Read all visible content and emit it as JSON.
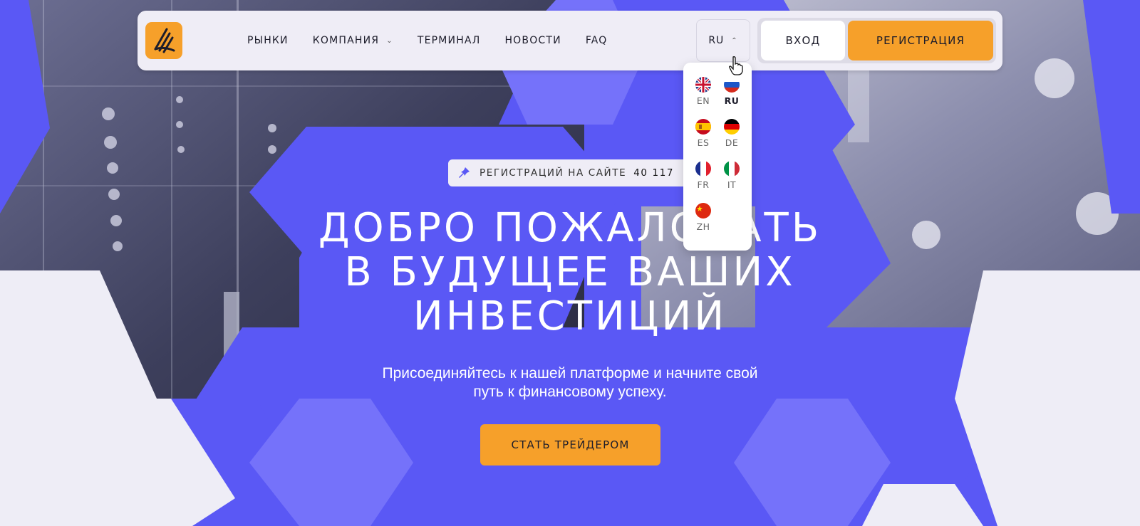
{
  "colors": {
    "accent": "#5a58f5",
    "brand_orange": "#f6a02a",
    "light": "#efedf6"
  },
  "header": {
    "logo_icon": "brand-logo-icon",
    "nav": [
      {
        "label": "РЫНКИ",
        "has_dropdown": false
      },
      {
        "label": "КОМПАНИЯ",
        "has_dropdown": true
      },
      {
        "label": "ТЕРМИНАЛ",
        "has_dropdown": false
      },
      {
        "label": "НОВОСТИ",
        "has_dropdown": false
      },
      {
        "label": "FAQ",
        "has_dropdown": false
      }
    ],
    "language": {
      "current": "RU",
      "chevron_icon": "chevron-up-icon"
    },
    "login_label": "ВХОД",
    "register_label": "РЕГИСТРАЦИЯ"
  },
  "language_menu": {
    "options": [
      {
        "code": "EN",
        "flag": "uk-flag-icon",
        "active": false
      },
      {
        "code": "RU",
        "flag": "russia-flag-icon",
        "active": true
      },
      {
        "code": "ES",
        "flag": "spain-flag-icon",
        "active": false
      },
      {
        "code": "DE",
        "flag": "germany-flag-icon",
        "active": false
      },
      {
        "code": "FR",
        "flag": "france-flag-icon",
        "active": false
      },
      {
        "code": "IT",
        "flag": "italy-flag-icon",
        "active": false
      },
      {
        "code": "ZH",
        "flag": "china-flag-icon",
        "active": false
      }
    ]
  },
  "hero": {
    "badge_label": "РЕГИСТРАЦИЙ НА САЙТЕ",
    "badge_count": "40 117",
    "badge_icon": "pin-icon",
    "title_lines": [
      "ДОБРО ПОЖАЛОВАТЬ",
      "В БУДУЩЕЕ ВАШИХ",
      "ИНВЕСТИЦИЙ"
    ],
    "subtitle_lines": [
      "Присоединяйтесь к нашей платформе и начните свой",
      "путь к финансовому успеху."
    ],
    "cta_label": "СТАТЬ ТРЕЙДЕРОМ"
  }
}
